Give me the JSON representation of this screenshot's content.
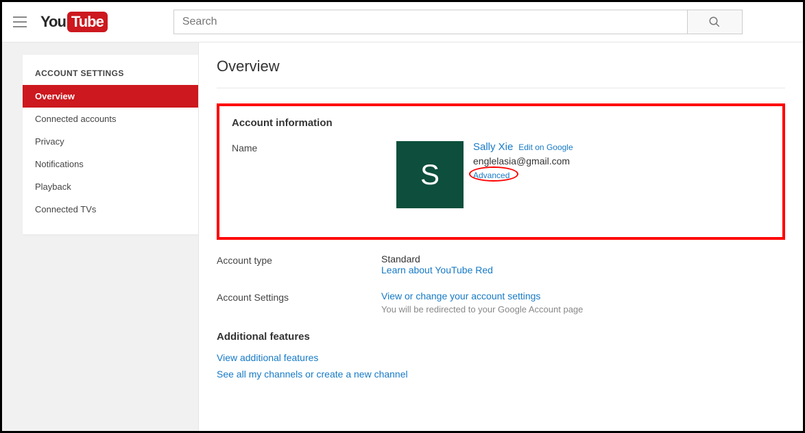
{
  "header": {
    "logo_you": "You",
    "logo_tube": "Tube",
    "search_placeholder": "Search"
  },
  "sidebar": {
    "title": "ACCOUNT SETTINGS",
    "items": [
      {
        "label": "Overview",
        "active": true
      },
      {
        "label": "Connected accounts",
        "active": false
      },
      {
        "label": "Privacy",
        "active": false
      },
      {
        "label": "Notifications",
        "active": false
      },
      {
        "label": "Playback",
        "active": false
      },
      {
        "label": "Connected TVs",
        "active": false
      }
    ]
  },
  "main": {
    "page_title": "Overview",
    "account_info": {
      "section_title": "Account information",
      "name_label": "Name",
      "avatar_letter": "S",
      "user_name": "Sally Xie",
      "edit_link": "Edit on Google",
      "email": "englelasia@gmail.com",
      "advanced_link": "Advanced"
    },
    "account_type": {
      "label": "Account type",
      "value": "Standard",
      "learn_link": "Learn about YouTube Red"
    },
    "account_settings": {
      "label": "Account Settings",
      "link": "View or change your account settings",
      "note": "You will be redirected to your Google Account page"
    },
    "additional": {
      "section_title": "Additional features",
      "link1": "View additional features",
      "link2": "See all my channels or create a new channel"
    }
  }
}
